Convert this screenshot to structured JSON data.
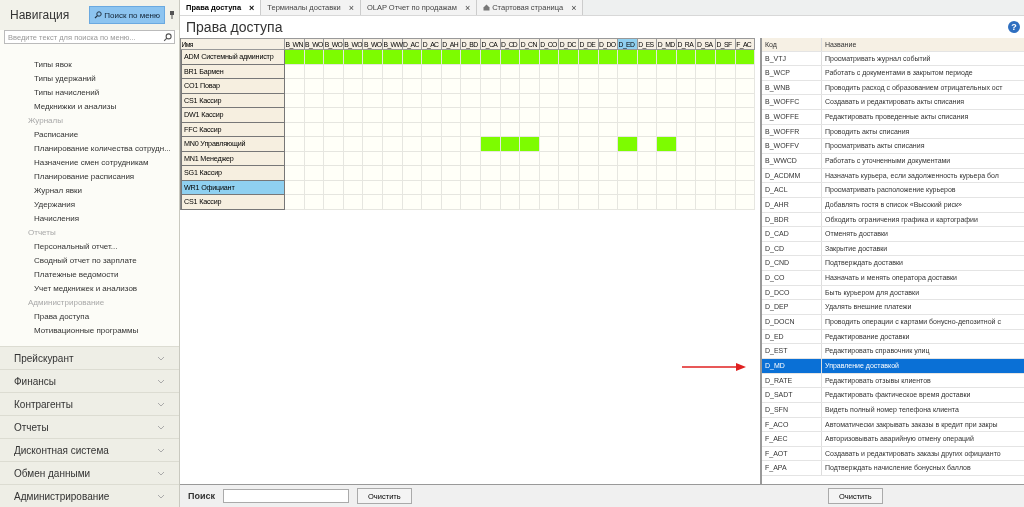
{
  "sidebar": {
    "title": "Навигация",
    "search_button": "Поиск по меню",
    "search": {
      "placeholder": "Введите текст для поиска по меню..."
    },
    "items": [
      {
        "kind": "item",
        "label": "Типы явок",
        "selected": false
      },
      {
        "kind": "item",
        "label": "Типы удержаний",
        "selected": false
      },
      {
        "kind": "item",
        "label": "Типы начислений",
        "selected": false
      },
      {
        "kind": "item",
        "label": "Медкнижки и анализы",
        "selected": false
      },
      {
        "kind": "section",
        "label": "Журналы",
        "selected": false
      },
      {
        "kind": "item",
        "label": "Расписание",
        "selected": false
      },
      {
        "kind": "item",
        "label": "Планирование количества сотрудн...",
        "selected": false
      },
      {
        "kind": "item",
        "label": "Назначение смен сотрудникам",
        "selected": false
      },
      {
        "kind": "item",
        "label": "Планирование расписания",
        "selected": false
      },
      {
        "kind": "item",
        "label": "Журнал явки",
        "selected": false
      },
      {
        "kind": "item",
        "label": "Удержания",
        "selected": false
      },
      {
        "kind": "item",
        "label": "Начисления",
        "selected": false
      },
      {
        "kind": "section",
        "label": "Отчеты",
        "selected": false
      },
      {
        "kind": "item",
        "label": "Персональный отчет...",
        "selected": false
      },
      {
        "kind": "item",
        "label": "Сводный отчет по зарплате",
        "selected": false
      },
      {
        "kind": "item",
        "label": "Платежные ведомости",
        "selected": false
      },
      {
        "kind": "item",
        "label": "Учет медкнижек и анализов",
        "selected": false
      },
      {
        "kind": "section",
        "label": "Администрирование",
        "selected": false
      },
      {
        "kind": "item",
        "label": "Права доступа",
        "selected": false
      },
      {
        "kind": "item",
        "label": "Мотивационные программы",
        "selected": false
      }
    ],
    "groups": [
      {
        "label": "Прейскурант",
        "expanded": false
      },
      {
        "label": "Финансы",
        "expanded": false
      },
      {
        "label": "Контрагенты",
        "expanded": false
      },
      {
        "label": "Отчеты",
        "expanded": false
      },
      {
        "label": "Дисконтная система",
        "expanded": false
      },
      {
        "label": "Обмен данными",
        "expanded": false
      },
      {
        "label": "Администрирование",
        "expanded": false
      }
    ]
  },
  "tabs": [
    {
      "label": "Права доступа",
      "close": "×",
      "selected": true,
      "kind": "plain"
    },
    {
      "label": "Терминалы доставки",
      "close": "×",
      "selected": false,
      "kind": "plain"
    },
    {
      "label": "OLAP Отчет по продажам",
      "close": "×",
      "selected": false,
      "kind": "plain"
    },
    {
      "label": "Стартовая страница",
      "close": "×",
      "selected": false,
      "kind": "home"
    }
  ],
  "page_title": "Права доступа",
  "matrix": {
    "name_header": "Имя",
    "columns": [
      {
        "label": "B_WN",
        "selected": false
      },
      {
        "label": "B_WO",
        "selected": false
      },
      {
        "label": "B_WO",
        "selected": false
      },
      {
        "label": "B_WO",
        "selected": false
      },
      {
        "label": "B_WO",
        "selected": false
      },
      {
        "label": "B_WW",
        "selected": false
      },
      {
        "label": "D_AC",
        "selected": false
      },
      {
        "label": "D_AC",
        "selected": false
      },
      {
        "label": "D_AH",
        "selected": false
      },
      {
        "label": "D_BD",
        "selected": false
      },
      {
        "label": "D_CA",
        "selected": false
      },
      {
        "label": "D_CD",
        "selected": false
      },
      {
        "label": "D_CN",
        "selected": false
      },
      {
        "label": "D_CO",
        "selected": false
      },
      {
        "label": "D_DC",
        "selected": false
      },
      {
        "label": "D_DE",
        "selected": false
      },
      {
        "label": "D_DO",
        "selected": false
      },
      {
        "label": "D_ED",
        "selected": true
      },
      {
        "label": "D_ES",
        "selected": false
      },
      {
        "label": "D_MD",
        "selected": false
      },
      {
        "label": "D_RA",
        "selected": false
      },
      {
        "label": "D_SA",
        "selected": false
      },
      {
        "label": "D_SF",
        "selected": false
      },
      {
        "label": "F_AC",
        "selected": false
      }
    ],
    "rows": [
      {
        "name": "ADM Системный администр",
        "selected": false,
        "granted": [
          true,
          true,
          true,
          true,
          true,
          true,
          true,
          true,
          true,
          true,
          true,
          true,
          true,
          true,
          true,
          true,
          true,
          true,
          true,
          true,
          true,
          true,
          true,
          true
        ]
      },
      {
        "name": "BR1 Бармен",
        "selected": false,
        "granted": [
          false,
          false,
          false,
          false,
          false,
          false,
          false,
          false,
          false,
          false,
          false,
          false,
          false,
          false,
          false,
          false,
          false,
          false,
          false,
          false,
          false,
          false,
          false,
          false
        ]
      },
      {
        "name": "CO1 Повар",
        "selected": false,
        "granted": [
          false,
          false,
          false,
          false,
          false,
          false,
          false,
          false,
          false,
          false,
          false,
          false,
          false,
          false,
          false,
          false,
          false,
          false,
          false,
          false,
          false,
          false,
          false,
          false
        ]
      },
      {
        "name": "CS1 Кассир",
        "selected": false,
        "granted": [
          false,
          false,
          false,
          false,
          false,
          false,
          false,
          false,
          false,
          false,
          false,
          false,
          false,
          false,
          false,
          false,
          false,
          false,
          false,
          false,
          false,
          false,
          false,
          false
        ]
      },
      {
        "name": "DW1 Кассир",
        "selected": false,
        "granted": [
          false,
          false,
          false,
          false,
          false,
          false,
          false,
          false,
          false,
          false,
          false,
          false,
          false,
          false,
          false,
          false,
          false,
          false,
          false,
          false,
          false,
          false,
          false,
          false
        ]
      },
      {
        "name": "FFC Кассир",
        "selected": false,
        "granted": [
          false,
          false,
          false,
          false,
          false,
          false,
          false,
          false,
          false,
          false,
          false,
          false,
          false,
          false,
          false,
          false,
          false,
          false,
          false,
          false,
          false,
          false,
          false,
          false
        ]
      },
      {
        "name": "MN0 Управляющий",
        "selected": false,
        "granted": [
          false,
          false,
          false,
          false,
          false,
          false,
          false,
          false,
          false,
          false,
          true,
          true,
          true,
          false,
          false,
          false,
          false,
          true,
          false,
          true,
          false,
          false,
          false,
          false
        ]
      },
      {
        "name": "MN1 Менеджер",
        "selected": false,
        "granted": [
          false,
          false,
          false,
          false,
          false,
          false,
          false,
          false,
          false,
          false,
          false,
          false,
          false,
          false,
          false,
          false,
          false,
          false,
          false,
          false,
          false,
          false,
          false,
          false
        ]
      },
      {
        "name": "SG1 Кассир",
        "selected": false,
        "granted": [
          false,
          false,
          false,
          false,
          false,
          false,
          false,
          false,
          false,
          false,
          false,
          false,
          false,
          false,
          false,
          false,
          false,
          false,
          false,
          false,
          false,
          false,
          false,
          false
        ]
      },
      {
        "name": "WR1 Официант",
        "selected": true,
        "granted": [
          false,
          false,
          false,
          false,
          false,
          false,
          false,
          false,
          false,
          false,
          false,
          false,
          false,
          false,
          false,
          false,
          false,
          false,
          false,
          false,
          false,
          false,
          false,
          false
        ]
      },
      {
        "name": "CS1 Кассир",
        "selected": false,
        "granted": [
          false,
          false,
          false,
          false,
          false,
          false,
          false,
          false,
          false,
          false,
          false,
          false,
          false,
          false,
          false,
          false,
          false,
          false,
          false,
          false,
          false,
          false,
          false,
          false
        ]
      }
    ]
  },
  "permissions": {
    "columns": [
      "Код",
      "Название"
    ],
    "rows": [
      {
        "code": "B_VTJ",
        "name": "Просматривать журнал событий",
        "selected": false
      },
      {
        "code": "B_WCP",
        "name": "Работать с документами в закрытом периоде",
        "selected": false
      },
      {
        "code": "B_WNB",
        "name": "Проводить расход с образованием отрицательных ост",
        "selected": false
      },
      {
        "code": "B_WOFFC",
        "name": "Создавать и редактировать акты списания",
        "selected": false
      },
      {
        "code": "B_WOFFE",
        "name": "Редактировать проведенные акты списания",
        "selected": false
      },
      {
        "code": "B_WOFFR",
        "name": "Проводить акты списания",
        "selected": false
      },
      {
        "code": "B_WOFFV",
        "name": "Просматривать акты списания",
        "selected": false
      },
      {
        "code": "B_WWCD",
        "name": "Работать с уточненными документами",
        "selected": false
      },
      {
        "code": "D_ACDMM",
        "name": "Назначать курьера, если задолженность курьера бол",
        "selected": false
      },
      {
        "code": "D_ACL",
        "name": "Просматривать расположение курьеров",
        "selected": false
      },
      {
        "code": "D_AHR",
        "name": "Добавлять гостя в список «Высокий риск»",
        "selected": false
      },
      {
        "code": "D_BDR",
        "name": "Обходить ограничения графика и картографии",
        "selected": false
      },
      {
        "code": "D_CAD",
        "name": "Отменять доставки",
        "selected": false
      },
      {
        "code": "D_CD",
        "name": "Закрытие доставки",
        "selected": false
      },
      {
        "code": "D_CND",
        "name": "Подтверждать доставки",
        "selected": false
      },
      {
        "code": "D_CO",
        "name": "Назначать и менять оператора доставки",
        "selected": false
      },
      {
        "code": "D_DCO",
        "name": "Быть курьером для доставки",
        "selected": false
      },
      {
        "code": "D_DEP",
        "name": "Удалять внешние платежи",
        "selected": false
      },
      {
        "code": "D_DOCN",
        "name": "Проводить операции с картами бонусно-депозитной с",
        "selected": false
      },
      {
        "code": "D_ED",
        "name": "Редактирование доставки",
        "selected": false
      },
      {
        "code": "D_EST",
        "name": "Редактировать справочник улиц",
        "selected": false
      },
      {
        "code": "D_MD",
        "name": "Управление доставкой",
        "selected": true
      },
      {
        "code": "D_RATE",
        "name": "Редактировать отзывы клиентов",
        "selected": false
      },
      {
        "code": "D_SADT",
        "name": "Редактировать фактическое время доставки",
        "selected": false
      },
      {
        "code": "D_SFN",
        "name": "Видеть полный номер телефона клиента",
        "selected": false
      },
      {
        "code": "F_ACO",
        "name": "Автоматически закрывать заказы в кредит при закры",
        "selected": false
      },
      {
        "code": "F_AEC",
        "name": "Авторизовывать аварийную отмену операций",
        "selected": false
      },
      {
        "code": "F_AOT",
        "name": "Создавать и редактировать заказы других официанто",
        "selected": false
      },
      {
        "code": "F_APA",
        "name": "Подтверждать начисление бонусных баллов",
        "selected": false
      }
    ]
  },
  "bottom": {
    "search_label": "Поиск",
    "clear_button": "Очистить",
    "permissions_clear_button": "Очистить"
  },
  "help": "?"
}
